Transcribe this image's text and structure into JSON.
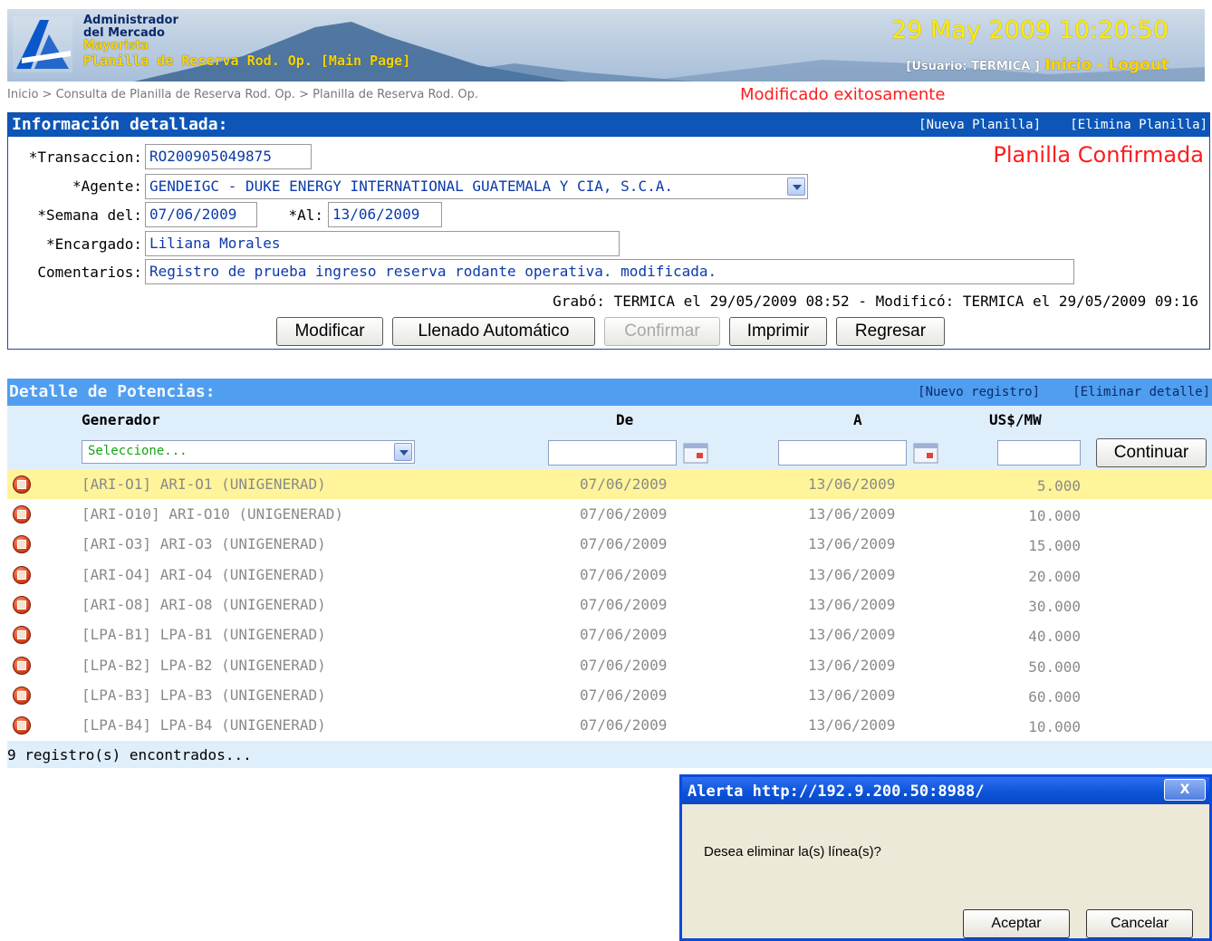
{
  "header": {
    "org_line1": "Administrador",
    "org_line2": "del Mercado",
    "org_line3": "Mayorista",
    "page_heading": "Planilla de Reserva Rod. Op. [Main Page]",
    "datetime": "29 May 2009 10:20:50",
    "user_label": "[Usuario: TERMICA ]",
    "inicio_link": "Inicio",
    "separator": "-",
    "logout_link": "Logout",
    "icons": [
      "amm-logo-icon"
    ]
  },
  "breadcrumb": {
    "item1": "Inicio",
    "sep": ">",
    "item2": "Consulta de Planilla de Reserva Rod. Op.",
    "item3": "Planilla de Reserva Rod. Op."
  },
  "success_message": "Modificado exitosamente",
  "detail": {
    "title": "Información detallada:",
    "nueva_planilla": "[Nueva Planilla]",
    "elimina_planilla": "[Elimina Planilla]",
    "status": "Planilla Confirmada",
    "fields": {
      "transaccion_label": "*Transaccion:",
      "transaccion_value": "RO200905049875",
      "agente_label": "*Agente:",
      "agente_value": "GENDEIGC - DUKE ENERGY INTERNATIONAL GUATEMALA Y CIA, S.C.A.",
      "semana_label": "*Semana del:",
      "semana_value": "07/06/2009",
      "al_label": "*Al:",
      "al_value": "13/06/2009",
      "encargado_label": "*Encargado:",
      "encargado_value": "Liliana Morales",
      "comentarios_label": "Comentarios:",
      "comentarios_value": "Registro de prueba ingreso reserva rodante operativa. modificada."
    },
    "audit": "Grabó: TERMICA el 29/05/2009 08:52 - Modificó: TERMICA el 29/05/2009 09:16",
    "buttons": {
      "modificar": "Modificar",
      "llenado": "Llenado Automático",
      "confirmar": "Confirmar",
      "imprimir": "Imprimir",
      "regresar": "Regresar"
    }
  },
  "potencias": {
    "title": "Detalle de Potencias:",
    "nuevo_registro": "[Nuevo registro]",
    "eliminar_detalle": "[Eliminar detalle]",
    "columns": {
      "generador": "Generador",
      "de": "De",
      "a": "A",
      "usmw": "US$/MW"
    },
    "generator_select": "Seleccione...",
    "continuar": "Continuar",
    "rows": [
      {
        "generador": "[ARI-O1] ARI-O1 (UNIGENERAD)",
        "de": "07/06/2009",
        "a": "13/06/2009",
        "usmw": "5.000"
      },
      {
        "generador": "[ARI-O10] ARI-O10 (UNIGENERAD)",
        "de": "07/06/2009",
        "a": "13/06/2009",
        "usmw": "10.000"
      },
      {
        "generador": "[ARI-O3] ARI-O3 (UNIGENERAD)",
        "de": "07/06/2009",
        "a": "13/06/2009",
        "usmw": "15.000"
      },
      {
        "generador": "[ARI-O4] ARI-O4 (UNIGENERAD)",
        "de": "07/06/2009",
        "a": "13/06/2009",
        "usmw": "20.000"
      },
      {
        "generador": "[ARI-O8] ARI-O8 (UNIGENERAD)",
        "de": "07/06/2009",
        "a": "13/06/2009",
        "usmw": "30.000"
      },
      {
        "generador": "[LPA-B1] LPA-B1 (UNIGENERAD)",
        "de": "07/06/2009",
        "a": "13/06/2009",
        "usmw": "40.000"
      },
      {
        "generador": "[LPA-B2] LPA-B2 (UNIGENERAD)",
        "de": "07/06/2009",
        "a": "13/06/2009",
        "usmw": "50.000"
      },
      {
        "generador": "[LPA-B3] LPA-B3 (UNIGENERAD)",
        "de": "07/06/2009",
        "a": "13/06/2009",
        "usmw": "60.000"
      },
      {
        "generador": "[LPA-B4] LPA-B4 (UNIGENERAD)",
        "de": "07/06/2009",
        "a": "13/06/2009",
        "usmw": "10.000"
      }
    ],
    "row_count": "9 registro(s) encontrados..."
  },
  "dialog": {
    "title": "Alerta http://192.9.200.50:8988/",
    "close": "X",
    "message": "Desea eliminar la(s) línea(s)?",
    "accept": "Aceptar",
    "cancel": "Cancelar"
  },
  "colors": {
    "detail_bar": "#0d56b7",
    "potencias_bar": "#4f9ef0",
    "highlight_row": "#fff49a",
    "status_red": "#ff1c1c",
    "header_yellow": "#ffd400"
  }
}
